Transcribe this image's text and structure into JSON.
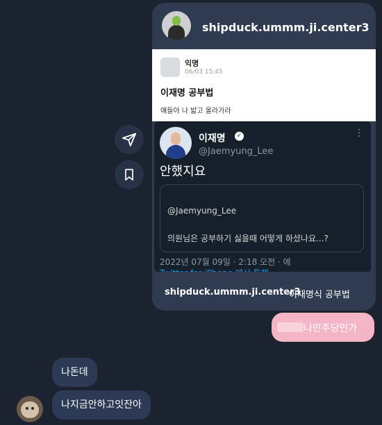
{
  "shared_card": {
    "username": "shipduck.ummm.ji.center3",
    "post": {
      "author": "익명",
      "date": "06/03 15:45",
      "title": "이재명 공부법",
      "body": "얘들아 나 밟고 올라가라"
    },
    "tweet": {
      "name": "이재명",
      "handle": "@Jaemyung_Lee",
      "text": "안했지요",
      "quote_handle": "@Jaemyung_Lee",
      "quote_text": "의원님은 공부하기 싫을때 어떻게 하셨나요...?",
      "timestamp": "2022년 07월 09일 · 2:18 오전 · 에",
      "source": "Twitter for iPhone 에서 통해"
    },
    "caption_user": "shipduck.ummm.ji.center3",
    "caption_text": "이재명식 공부법"
  },
  "actions": {
    "share_icon": "send-icon",
    "save_icon": "bookmark-icon"
  },
  "messages": {
    "mine": "나민주당인가",
    "theirs": [
      "나돈데",
      "나지금안하고잇잔아"
    ]
  },
  "colors": {
    "background": "#1b2331",
    "card": "#2f3b50",
    "my_bubble": "#f4b5c6",
    "their_bubble": "#2c3a55",
    "twitter_bg": "#15202b"
  }
}
